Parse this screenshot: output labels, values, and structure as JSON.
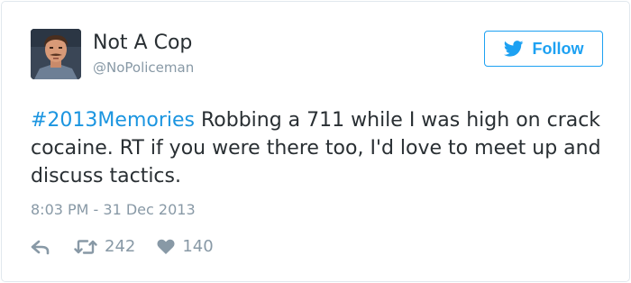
{
  "author": {
    "display_name": "Not A Cop",
    "handle": "@NoPoliceman",
    "avatar_icon": "profile-photo"
  },
  "follow_button": {
    "label": "Follow",
    "icon": "twitter-bird-icon"
  },
  "tweet": {
    "hashtag": "#2013Memories",
    "body": " Robbing a 711 while I was high on crack cocaine. RT if you were there too, I'd love to meet up and discuss tactics.",
    "timestamp": "8:03 PM - 31 Dec 2013"
  },
  "stats": {
    "retweets": "242",
    "likes": "140"
  },
  "colors": {
    "accent": "#1da1f2",
    "hashtag": "#1b95e0",
    "text": "#292f33",
    "muted": "#8899a6",
    "border": "#e1e8ed"
  }
}
